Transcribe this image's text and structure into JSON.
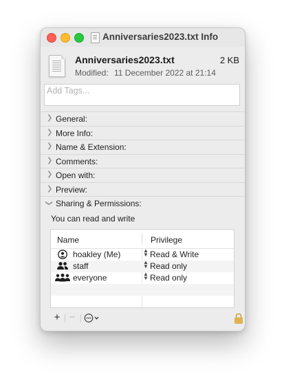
{
  "window": {
    "title": "Anniversaries2023.txt Info"
  },
  "file": {
    "name": "Anniversaries2023.txt",
    "size": "2 KB",
    "modified_label": "Modified:",
    "modified_value": "11 December 2022 at 21:14"
  },
  "tags": {
    "placeholder": "Add Tags..."
  },
  "sections": [
    {
      "label": "General:",
      "expanded": false
    },
    {
      "label": "More Info:",
      "expanded": false
    },
    {
      "label": "Name & Extension:",
      "expanded": false
    },
    {
      "label": "Comments:",
      "expanded": false
    },
    {
      "label": "Open with:",
      "expanded": false
    },
    {
      "label": "Preview:",
      "expanded": false
    },
    {
      "label": "Sharing & Permissions:",
      "expanded": true
    }
  ],
  "permissions": {
    "summary": "You can read and write",
    "columns": {
      "name": "Name",
      "privilege": "Privilege"
    },
    "rows": [
      {
        "name": "hoakley (Me)",
        "privilege": "Read & Write",
        "icon": "single-user-icon"
      },
      {
        "name": "staff",
        "privilege": "Read only",
        "icon": "group-icon"
      },
      {
        "name": "everyone",
        "privilege": "Read only",
        "icon": "everyone-icon"
      }
    ]
  },
  "footer": {
    "add": "+",
    "remove": "−",
    "more": "⋯"
  },
  "colors": {
    "close": "#fe5f57",
    "minimize": "#febc2e",
    "zoom": "#28c840",
    "lock": "#e3b24b"
  }
}
